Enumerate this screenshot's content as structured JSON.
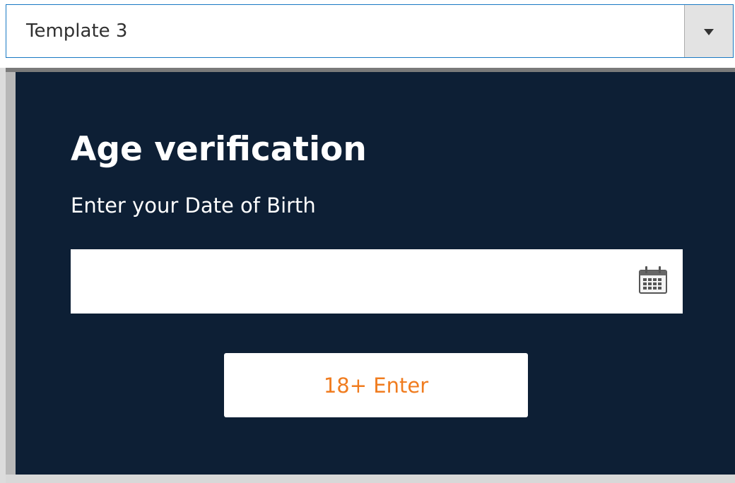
{
  "template_select": {
    "selected": "Template 3"
  },
  "modal": {
    "title": "Age verification",
    "subtitle": "Enter your Date of Birth",
    "dob_value": "",
    "button_label": "18+ Enter"
  },
  "colors": {
    "modal_background": "#0d1f35",
    "button_text": "#f07c1f",
    "select_border": "#1979c3"
  },
  "icons": {
    "select_toggle": "caret-down-icon",
    "date_picker": "calendar-icon"
  }
}
